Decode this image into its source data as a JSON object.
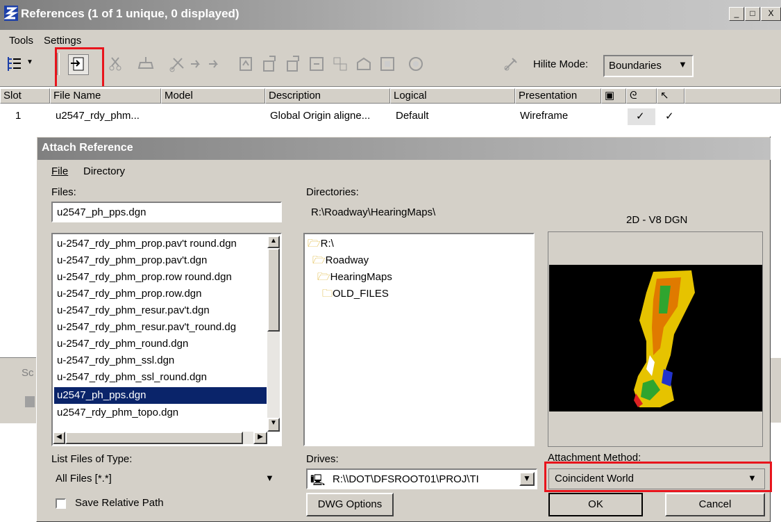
{
  "window": {
    "title": "References (1 of 1 unique, 0 displayed)",
    "menu": [
      "Tools",
      "Settings"
    ]
  },
  "toolbar": {
    "hilite_label": "Hilite Mode:",
    "hilite_value": "Boundaries",
    "icons": [
      "list-view-icon",
      "attach-reference-icon",
      "detach-icon",
      "reload-icon",
      "clip-boundary-icon",
      "move-icon",
      "copy-icon",
      "rotate-icon",
      "scale-icon",
      "mirror-h-icon",
      "mirror-v-icon",
      "clip-front-icon",
      "clip-back-icon",
      "clip-mask-icon",
      "delete-clip-icon",
      "settings-icon"
    ]
  },
  "ref_table": {
    "headers": [
      "Slot",
      "File Name",
      "Model",
      "Description",
      "Logical",
      "Presentation"
    ],
    "rows": [
      {
        "slot": "1",
        "file": "u2547_rdy_phm...",
        "model": "",
        "description": "Global Origin aligne...",
        "logical": "Default",
        "presentation": "Wireframe",
        "display": "✓",
        "snap": "✓"
      }
    ]
  },
  "background_partial": {
    "left_label": "Sc"
  },
  "attach": {
    "title": "Attach Reference",
    "menu": [
      "File",
      "Directory"
    ],
    "files_label": "Files:",
    "file_input": "u2547_ph_pps.dgn",
    "directories_label": "Directories:",
    "current_dir": "R:\\Roadway\\HearingMaps\\",
    "preview_label": "2D - V8 DGN",
    "files": [
      "u-2547_rdy_phm_prop.pav't round.dgn",
      "u-2547_rdy_phm_prop.pav't.dgn",
      "u-2547_rdy_phm_prop.row round.dgn",
      "u-2547_rdy_phm_prop.row.dgn",
      "u-2547_rdy_phm_resur.pav't.dgn",
      "u-2547_rdy_phm_resur.pav't_round.dg",
      "u-2547_rdy_phm_round.dgn",
      "u-2547_rdy_phm_ssl.dgn",
      "u-2547_rdy_phm_ssl_round.dgn",
      "u2547_ph_pps.dgn",
      "u2547_rdy_phm_topo.dgn"
    ],
    "selected_file_index": 9,
    "directories": [
      "R:\\",
      "Roadway",
      "HearingMaps",
      "OLD_FILES"
    ],
    "list_type_label": "List Files of Type:",
    "list_type_value": "All Files [*.*]",
    "drives_label": "Drives:",
    "drives_value": "R:\\\\DOT\\DFSROOT01\\PROJ\\TI",
    "method_label": "Attachment Method:",
    "method_value": "Coincident World",
    "save_relative_label": "Save Relative Path",
    "dwg_options_label": "DWG Options",
    "ok_label": "OK",
    "cancel_label": "Cancel"
  },
  "colors": {
    "selection": "#0a246a",
    "highlight": "#e8141c",
    "dialog": "#d4d0c8",
    "preview_bg": "#000000"
  }
}
